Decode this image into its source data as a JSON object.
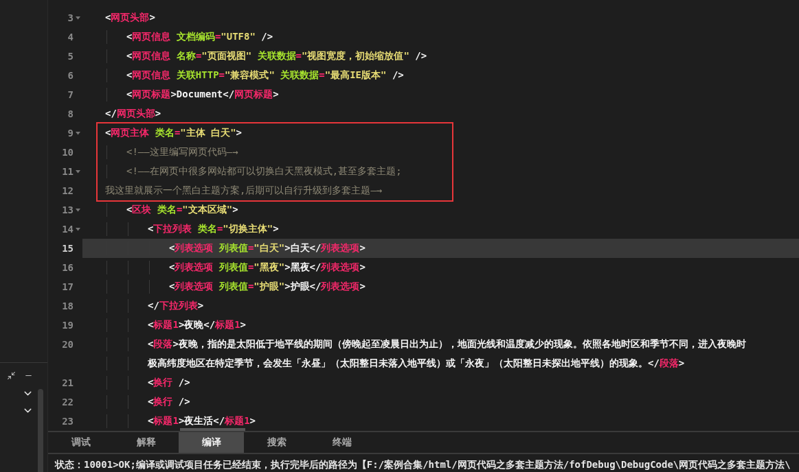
{
  "editor": {
    "lines": [
      {
        "number": "3",
        "foldable": true,
        "selected": false,
        "boxed": false,
        "tokens": [
          {
            "kind": "punct",
            "text": "<"
          },
          {
            "kind": "tag",
            "text": "网页头部"
          },
          {
            "kind": "punct",
            "text": ">"
          }
        ],
        "children": [
          {
            "number": "4",
            "foldable": false,
            "selected": false,
            "boxed": false,
            "tokens": [
              {
                "kind": "punct",
                "text": "<"
              },
              {
                "kind": "tag",
                "text": "网页信息"
              },
              {
                "kind": "attr",
                "text": " 文档编码"
              },
              {
                "kind": "eq",
                "text": "="
              },
              {
                "kind": "str",
                "text": "\"UTF8\""
              },
              {
                "kind": "punct",
                "text": " />"
              }
            ]
          },
          {
            "number": "5",
            "foldable": false,
            "selected": false,
            "boxed": false,
            "tokens": [
              {
                "kind": "punct",
                "text": "<"
              },
              {
                "kind": "tag",
                "text": "网页信息"
              },
              {
                "kind": "attr",
                "text": " 名称"
              },
              {
                "kind": "eq",
                "text": "="
              },
              {
                "kind": "str",
                "text": "\"页面视图\""
              },
              {
                "kind": "attr",
                "text": " 关联数据"
              },
              {
                "kind": "eq",
                "text": "="
              },
              {
                "kind": "str",
                "text": "\"视图宽度，初始缩放值\""
              },
              {
                "kind": "punct",
                "text": " />"
              }
            ]
          },
          {
            "number": "6",
            "foldable": false,
            "selected": false,
            "boxed": false,
            "tokens": [
              {
                "kind": "punct",
                "text": "<"
              },
              {
                "kind": "tag",
                "text": "网页信息"
              },
              {
                "kind": "attr",
                "text": " 关联HTTP"
              },
              {
                "kind": "eq",
                "text": "="
              },
              {
                "kind": "str",
                "text": "\"兼容模式\""
              },
              {
                "kind": "attr",
                "text": " 关联数据"
              },
              {
                "kind": "eq",
                "text": "="
              },
              {
                "kind": "str",
                "text": "\"最高IE版本\""
              },
              {
                "kind": "punct",
                "text": " />"
              }
            ]
          },
          {
            "number": "7",
            "foldable": false,
            "selected": false,
            "boxed": false,
            "tokens": [
              {
                "kind": "punct",
                "text": "<"
              },
              {
                "kind": "tag",
                "text": "网页标题"
              },
              {
                "kind": "text",
                "text": ">Document</"
              },
              {
                "kind": "tag",
                "text": "网页标题"
              },
              {
                "kind": "punct",
                "text": ">"
              }
            ]
          }
        ]
      },
      {
        "number": "8",
        "foldable": false,
        "selected": false,
        "boxed": false,
        "tokens": [
          {
            "kind": "punct",
            "text": "</"
          },
          {
            "kind": "tag",
            "text": "网页头部"
          },
          {
            "kind": "punct",
            "text": ">"
          }
        ]
      },
      {
        "number": "9",
        "foldable": true,
        "selected": false,
        "boxed": true,
        "tokens": [
          {
            "kind": "punct",
            "text": "<"
          },
          {
            "kind": "tag",
            "text": "网页主体"
          },
          {
            "kind": "attr",
            "text": " 类名"
          },
          {
            "kind": "eq",
            "text": "="
          },
          {
            "kind": "str",
            "text": "\"主体 白天\""
          },
          {
            "kind": "punct",
            "text": ">"
          }
        ],
        "children": [
          {
            "number": "10",
            "foldable": false,
            "selected": false,
            "boxed": true,
            "tokens": [
              {
                "kind": "comment",
                "text": "<!——这里编写网页代码—→"
              }
            ]
          },
          {
            "number": "11",
            "foldable": true,
            "selected": false,
            "boxed": true,
            "tokens": [
              {
                "kind": "comment",
                "text": "<!——在网页中很多网站都可以切换白天黑夜模式,甚至多套主题;"
              }
            ]
          }
        ]
      },
      {
        "number": "12",
        "foldable": false,
        "selected": false,
        "boxed": true,
        "tokens": [
          {
            "kind": "comment",
            "text": "我这里就展示一个黑白主题方案,后期可以自行升级到多套主题—→"
          }
        ],
        "children": [
          {
            "number": "13",
            "foldable": true,
            "selected": false,
            "boxed": false,
            "tokens": [
              {
                "kind": "punct",
                "text": "<"
              },
              {
                "kind": "tag",
                "text": "区块"
              },
              {
                "kind": "attr",
                "text": " 类名"
              },
              {
                "kind": "eq",
                "text": "="
              },
              {
                "kind": "str",
                "text": "\"文本区域\""
              },
              {
                "kind": "punct",
                "text": ">"
              }
            ],
            "children": [
              {
                "number": "14",
                "foldable": true,
                "selected": false,
                "boxed": false,
                "tokens": [
                  {
                    "kind": "punct",
                    "text": "<"
                  },
                  {
                    "kind": "tag",
                    "text": "下拉列表"
                  },
                  {
                    "kind": "attr",
                    "text": " 类名"
                  },
                  {
                    "kind": "eq",
                    "text": "="
                  },
                  {
                    "kind": "str",
                    "text": "\"切换主体\""
                  },
                  {
                    "kind": "punct",
                    "text": ">"
                  }
                ],
                "children": [
                  {
                    "number": "15",
                    "foldable": false,
                    "selected": true,
                    "boxed": false,
                    "tokens": [
                      {
                        "kind": "punct",
                        "text": "<"
                      },
                      {
                        "kind": "tag",
                        "text": "列表选项"
                      },
                      {
                        "kind": "attr",
                        "text": " 列表值"
                      },
                      {
                        "kind": "eq",
                        "text": "="
                      },
                      {
                        "kind": "str",
                        "text": "\"白天\""
                      },
                      {
                        "kind": "text",
                        "text": ">白天</"
                      },
                      {
                        "kind": "tag",
                        "text": "列表选项"
                      },
                      {
                        "kind": "punct",
                        "text": ">"
                      }
                    ]
                  },
                  {
                    "number": "16",
                    "foldable": false,
                    "selected": false,
                    "boxed": false,
                    "tokens": [
                      {
                        "kind": "punct",
                        "text": "<"
                      },
                      {
                        "kind": "tag",
                        "text": "列表选项"
                      },
                      {
                        "kind": "attr",
                        "text": " 列表值"
                      },
                      {
                        "kind": "eq",
                        "text": "="
                      },
                      {
                        "kind": "str",
                        "text": "\"黑夜\""
                      },
                      {
                        "kind": "text",
                        "text": ">黑夜</"
                      },
                      {
                        "kind": "tag",
                        "text": "列表选项"
                      },
                      {
                        "kind": "punct",
                        "text": ">"
                      }
                    ]
                  },
                  {
                    "number": "17",
                    "foldable": false,
                    "selected": false,
                    "boxed": false,
                    "tokens": [
                      {
                        "kind": "punct",
                        "text": "<"
                      },
                      {
                        "kind": "tag",
                        "text": "列表选项"
                      },
                      {
                        "kind": "attr",
                        "text": " 列表值"
                      },
                      {
                        "kind": "eq",
                        "text": "="
                      },
                      {
                        "kind": "str",
                        "text": "\"护眼\""
                      },
                      {
                        "kind": "text",
                        "text": ">护眼</"
                      },
                      {
                        "kind": "tag",
                        "text": "列表选项"
                      },
                      {
                        "kind": "punct",
                        "text": ">"
                      }
                    ]
                  }
                ]
              },
              {
                "number": "18",
                "foldable": false,
                "selected": false,
                "boxed": false,
                "tokens": [
                  {
                    "kind": "punct",
                    "text": "</"
                  },
                  {
                    "kind": "tag",
                    "text": "下拉列表"
                  },
                  {
                    "kind": "punct",
                    "text": ">"
                  }
                ]
              },
              {
                "number": "19",
                "foldable": false,
                "selected": false,
                "boxed": false,
                "tokens": [
                  {
                    "kind": "punct",
                    "text": "<"
                  },
                  {
                    "kind": "tag",
                    "text": "标题1"
                  },
                  {
                    "kind": "text",
                    "text": ">夜晚</"
                  },
                  {
                    "kind": "tag",
                    "text": "标题1"
                  },
                  {
                    "kind": "punct",
                    "text": ">"
                  }
                ]
              },
              {
                "number": "20",
                "foldable": false,
                "selected": false,
                "boxed": false,
                "tokens": [
                  {
                    "kind": "punct",
                    "text": "<"
                  },
                  {
                    "kind": "tag",
                    "text": "段落"
                  },
                  {
                    "kind": "text",
                    "text": ">夜晚，指的是太阳低于地平线的期间（傍晚起至凌晨日出为止），地面光线和温度减少的现象。依照各地时区和季节不同，进入夜晚时"
                  }
                ],
                "wrap": [
                  {
                    "kind": "text",
                    "text": "极高纬度地区在特定季节，会发生「永昼」（太阳整日未落入地平线）或「永夜」（太阳整日未探出地平线）的现象。</"
                  },
                  {
                    "kind": "tag",
                    "text": "段落"
                  },
                  {
                    "kind": "punct",
                    "text": ">"
                  }
                ]
              },
              {
                "number": "21",
                "foldable": false,
                "selected": false,
                "boxed": false,
                "tokens": [
                  {
                    "kind": "punct",
                    "text": "<"
                  },
                  {
                    "kind": "tag",
                    "text": "换行"
                  },
                  {
                    "kind": "punct",
                    "text": " />"
                  }
                ]
              },
              {
                "number": "22",
                "foldable": false,
                "selected": false,
                "boxed": false,
                "tokens": [
                  {
                    "kind": "punct",
                    "text": "<"
                  },
                  {
                    "kind": "tag",
                    "text": "换行"
                  },
                  {
                    "kind": "punct",
                    "text": " />"
                  }
                ]
              },
              {
                "number": "23",
                "foldable": false,
                "selected": false,
                "boxed": false,
                "tokens": [
                  {
                    "kind": "punct",
                    "text": "<"
                  },
                  {
                    "kind": "tag",
                    "text": "标题1"
                  },
                  {
                    "kind": "text",
                    "text": ">夜生活</"
                  },
                  {
                    "kind": "tag",
                    "text": "标题1"
                  },
                  {
                    "kind": "punct",
                    "text": ">"
                  }
                ]
              }
            ]
          }
        ]
      }
    ]
  },
  "panel_tabs": [
    {
      "label": "调试",
      "selected": false
    },
    {
      "label": "解释",
      "selected": false
    },
    {
      "label": "编译",
      "selected": true
    },
    {
      "label": "搜索",
      "selected": false
    },
    {
      "label": "终端",
      "selected": false
    }
  ],
  "status_bar": {
    "text": "状态：10001>OK;编译或调试项目任务已经结束，执行完毕后的路径为【F:/案例合集/html/网页代码之多套主题方法/fofDebug\\DebugCode\\网页代码之多套主题方法\\"
  }
}
